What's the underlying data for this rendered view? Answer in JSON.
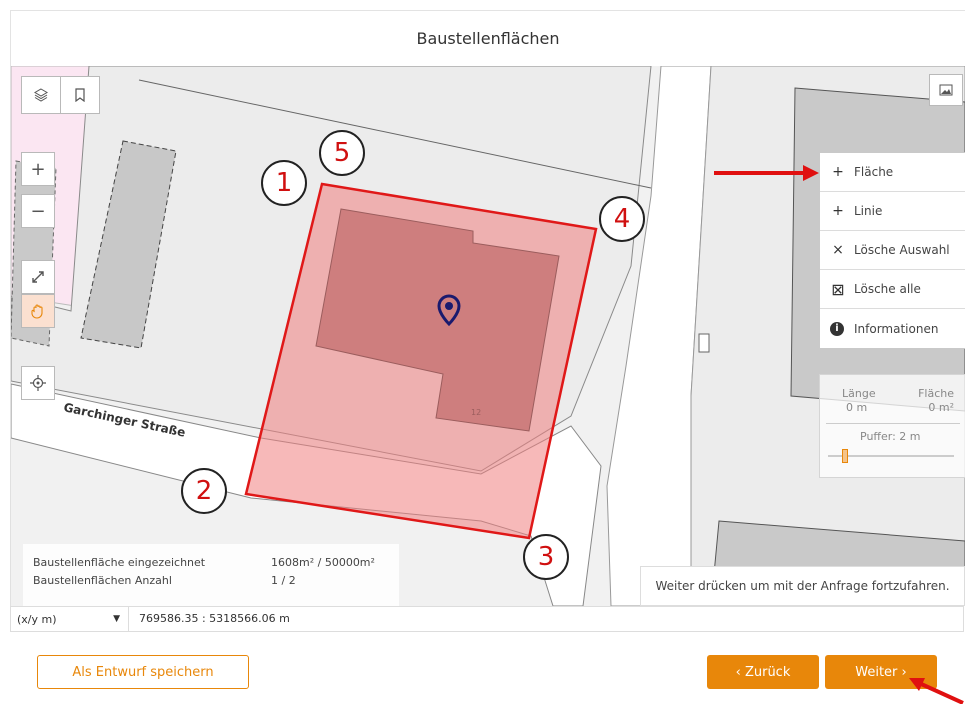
{
  "title": "Baustellenflächen",
  "map": {
    "street_name": "Garchinger Straße",
    "house_number": "12",
    "numbers": [
      "1",
      "2",
      "3",
      "4",
      "5"
    ]
  },
  "controls": {
    "layers": "layers-icon",
    "bookmark": "bookmark-icon",
    "zoom_in": "+",
    "zoom_out": "−",
    "fullscreen": "expand-icon",
    "pan": "hand-icon",
    "locate": "crosshair-icon",
    "image": "image-icon"
  },
  "menu": {
    "items": [
      {
        "icon": "+",
        "label": "Fläche"
      },
      {
        "icon": "+",
        "label": "Linie"
      },
      {
        "icon": "×",
        "label": "Lösche Auswahl"
      },
      {
        "icon": "⊠",
        "label": "Lösche alle"
      },
      {
        "icon": "i",
        "label": "Informationen"
      }
    ]
  },
  "measure": {
    "length_label": "Länge",
    "length_value": "0 m",
    "area_label": "Fläche",
    "area_value": "0 m²",
    "buffer_label": "Puffer: 2 m"
  },
  "info": {
    "row1_label": "Baustellenfläche eingezeichnet",
    "row1_value": "1608m² / 50000m²",
    "row2_label": "Baustellenflächen Anzahl",
    "row2_value": "1 / 2"
  },
  "hint": "Weiter drücken um mit der Anfrage fortzufahren.",
  "coords": {
    "unit_select": "(x/y m)",
    "value": "769586.35 : 5318566.06 m"
  },
  "footer": {
    "draft_button": "Als Entwurf speichern",
    "back_button": "‹ Zurück",
    "next_button": "Weiter ›"
  },
  "colors": {
    "accent": "#e8870a",
    "polygon_stroke": "#e01818",
    "polygon_fill": "#f08080",
    "annotation": "#e01010"
  }
}
